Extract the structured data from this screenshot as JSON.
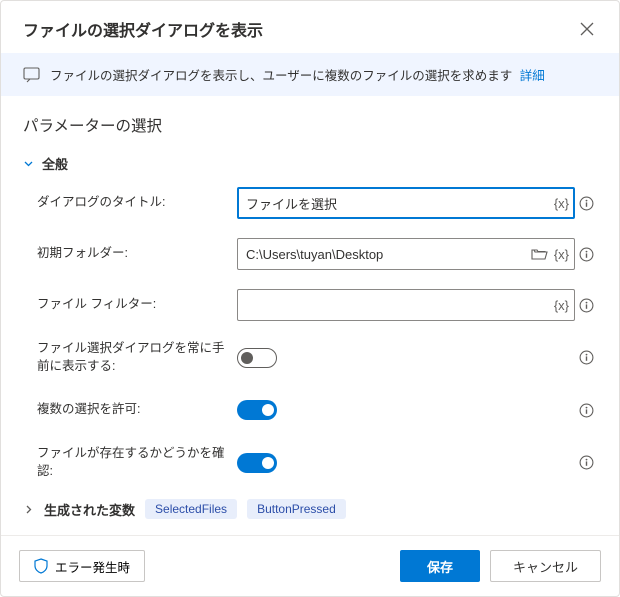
{
  "title": "ファイルの選択ダイアログを表示",
  "info": {
    "text": "ファイルの選択ダイアログを表示し、ユーザーに複数のファイルの選択を求めます",
    "detailsLabel": "詳細"
  },
  "sectionTitle": "パラメーターの選択",
  "groupGeneral": "全般",
  "params": {
    "dialogTitle": {
      "label": "ダイアログのタイトル:",
      "value": "ファイルを選択"
    },
    "initialFolder": {
      "label": "初期フォルダー:",
      "value": "C:\\Users\\tuyan\\Desktop"
    },
    "fileFilter": {
      "label": "ファイル フィルター:",
      "value": ""
    },
    "alwaysOnTop": {
      "label": "ファイル選択ダイアログを常に手前に表示する:"
    },
    "allowMultiple": {
      "label": "複数の選択を許可:"
    },
    "checkExists": {
      "label": "ファイルが存在するかどうかを確認:"
    }
  },
  "generatedVars": {
    "label": "生成された変数",
    "chips": [
      "SelectedFiles",
      "ButtonPressed"
    ]
  },
  "footer": {
    "onError": "エラー発生時",
    "save": "保存",
    "cancel": "キャンセル"
  },
  "glyphs": {
    "varBadge": "{x}"
  }
}
